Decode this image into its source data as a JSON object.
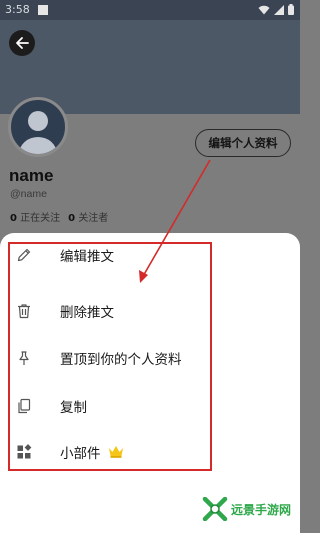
{
  "status_bar": {
    "time": "3:58"
  },
  "profile": {
    "name": "name",
    "handle": "@name",
    "following_count": "0",
    "following_label": "正在关注",
    "followers_count": "0",
    "followers_label": "关注者",
    "edit_button_label": "编辑个人资料"
  },
  "menu": {
    "items": [
      {
        "label": "编辑推文",
        "icon": "pencil-icon"
      },
      {
        "label": "删除推文",
        "icon": "trash-icon"
      },
      {
        "label": "置顶到你的个人资料",
        "icon": "pin-icon"
      },
      {
        "label": "复制",
        "icon": "copy-icon"
      },
      {
        "label": "小部件",
        "icon": "widgets-icon",
        "badge": "crown-icon"
      }
    ]
  },
  "watermark": {
    "text": "远景手游网"
  },
  "colors": {
    "annotation": "#d42a2a",
    "header": "#4d5866",
    "crown": "#f5c518",
    "watermark": "#2ea84a"
  }
}
